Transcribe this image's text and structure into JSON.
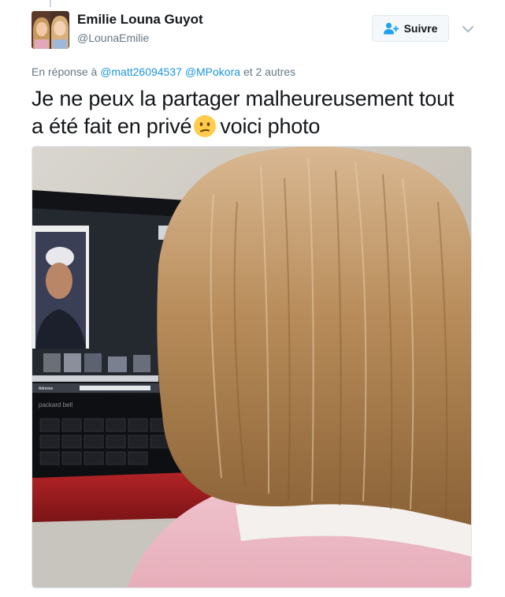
{
  "author": {
    "name": "Emilie Louna Guyot",
    "handle": "@LounaEmilie"
  },
  "follow_button": {
    "label": "Suivre",
    "icon": "add-user-icon"
  },
  "menu": {
    "icon": "chevron-down-icon"
  },
  "reply_context": {
    "prefix": "En réponse à",
    "mentions": [
      "@matt26094537",
      "@MPokora"
    ],
    "suffix": "et 2 autres"
  },
  "tweet": {
    "text_line1": "Je ne peux la partager malheureusement tout",
    "text_line2_before": "a été fait en privé",
    "emoji": "confused-face-emoji",
    "text_line2_after": "voici photo"
  },
  "photo": {
    "screen_label": "Adresse",
    "laptop_brand": "packard bell"
  },
  "colors": {
    "link": "#1b95e0",
    "secondary_text": "#657786",
    "button_bg": "#f5f8fa",
    "button_border": "#e1e8ed",
    "follow_icon": "#1da1f2"
  }
}
